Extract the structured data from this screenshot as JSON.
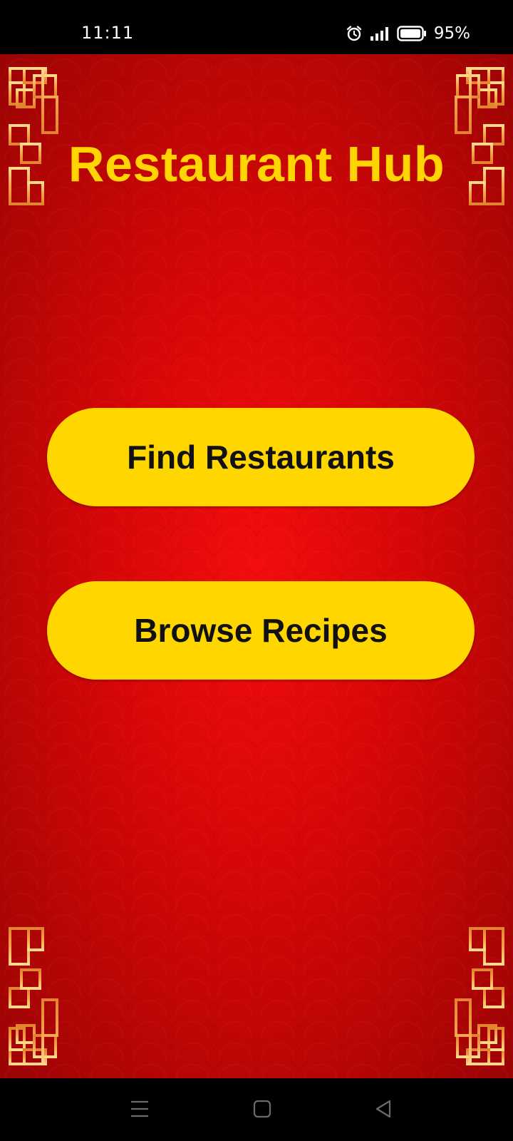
{
  "status_bar": {
    "time": "11:11",
    "icons": [
      "alarm-icon",
      "signal-icon",
      "battery-icon"
    ],
    "battery_percent": "95%"
  },
  "app": {
    "title": "Restaurant Hub",
    "buttons": {
      "find_restaurants": "Find Restaurants",
      "browse_recipes": "Browse Recipes"
    }
  },
  "nav_bar": {
    "icons": [
      "menu-icon",
      "home-icon",
      "back-icon"
    ]
  },
  "colors": {
    "background_red": "#d80707",
    "title_yellow": "#ffd400",
    "button_yellow": "#ffd600",
    "frame_gold": "#ffb347"
  }
}
